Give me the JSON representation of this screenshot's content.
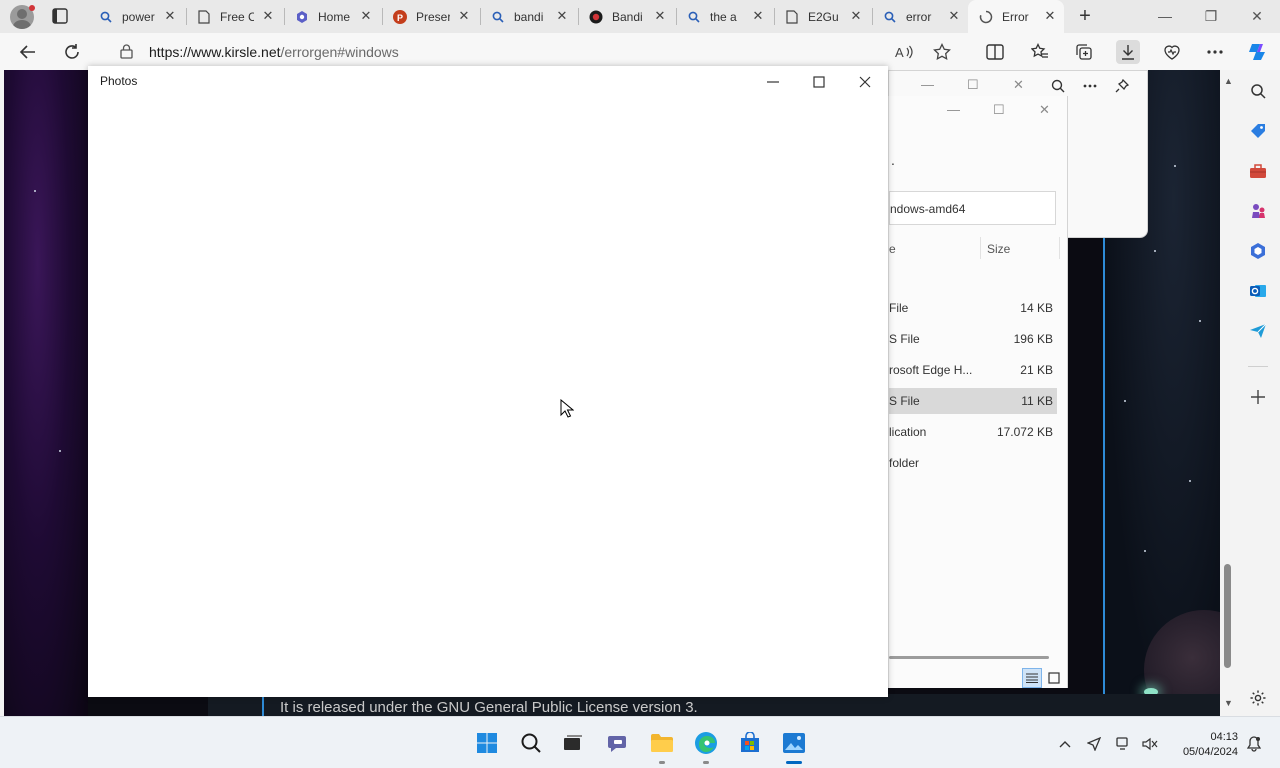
{
  "browser": {
    "tabs": [
      {
        "label": "power",
        "icon": "search-icon"
      },
      {
        "label": "Free C",
        "icon": "page-icon"
      },
      {
        "label": "Home",
        "icon": "copilot-icon"
      },
      {
        "label": "Preser",
        "icon": "powerpoint-icon"
      },
      {
        "label": "bandi",
        "icon": "search-icon"
      },
      {
        "label": "Bandi",
        "icon": "bandicam-icon"
      },
      {
        "label": "the a",
        "icon": "search-icon"
      },
      {
        "label": "E2Gu",
        "icon": "page-icon"
      },
      {
        "label": "error",
        "icon": "search-icon"
      },
      {
        "label": "Error",
        "icon": "loading-icon",
        "active": true
      }
    ],
    "url_domain": "https://www.kirsle.net",
    "url_path": "/errorgen#windows"
  },
  "photos_window": {
    "title": "Photos"
  },
  "explorer_window": {
    "path_fragment": "ndows-amd64",
    "header_mark": ".",
    "col_name_fragment": "e",
    "col_size": "Size",
    "files": [
      {
        "type": "File",
        "size": "14 KB",
        "selected": false
      },
      {
        "type": "S File",
        "size": "196 KB",
        "selected": false
      },
      {
        "type": "rosoft Edge H...",
        "size": "21 KB",
        "selected": false
      },
      {
        "type": "S File",
        "size": "11 KB",
        "selected": true
      },
      {
        "type": "lication",
        "size": "17.072 KB",
        "selected": false
      },
      {
        "type": "folder",
        "size": "",
        "selected": false
      }
    ]
  },
  "page": {
    "license_text": "It is released under the GNU General Public License version 3."
  },
  "taskbar": {
    "apps": [
      {
        "name": "start-button",
        "active": false,
        "running": false
      },
      {
        "name": "search-taskbar",
        "active": false,
        "running": false
      },
      {
        "name": "task-view",
        "active": false,
        "running": false
      },
      {
        "name": "teams-chat",
        "active": false,
        "running": false
      },
      {
        "name": "file-explorer",
        "active": false,
        "running": true
      },
      {
        "name": "edge",
        "active": false,
        "running": true
      },
      {
        "name": "microsoft-store",
        "active": false,
        "running": false
      },
      {
        "name": "photos",
        "active": true,
        "running": true
      }
    ],
    "time": "04:13",
    "date": "05/04/2024"
  },
  "colors": {
    "accent": "#0067c0",
    "selected_row": "#d9d9d9",
    "page_accent_line": "#2e8bd6"
  }
}
